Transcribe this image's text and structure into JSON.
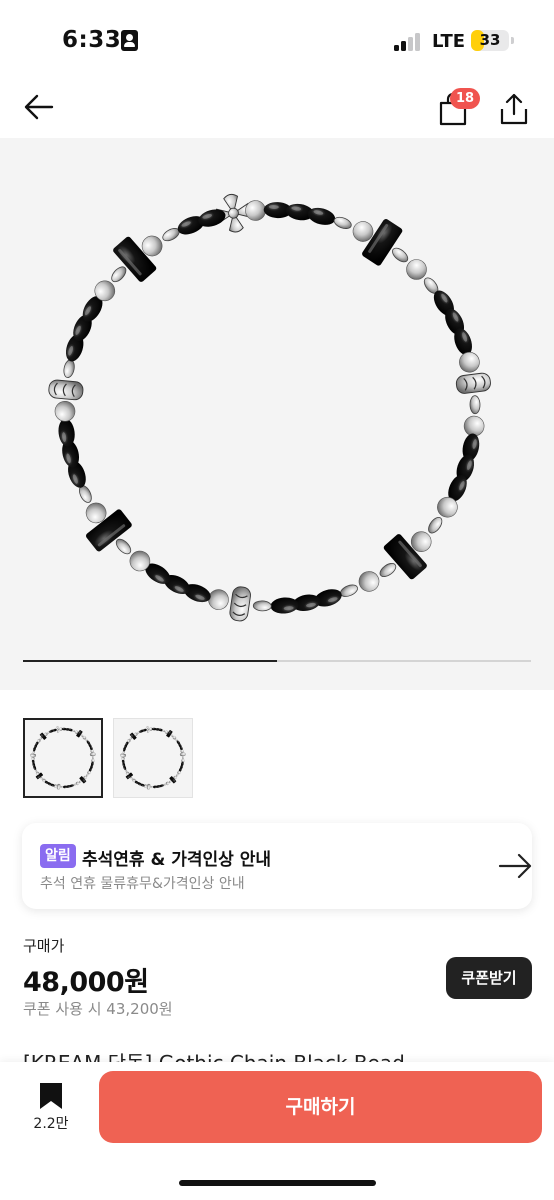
{
  "status_bar": {
    "time": "6:33",
    "network": "LTE",
    "battery_level": "33",
    "battery_color": "#ffcf0a",
    "person_icon": "person-badge-icon",
    "signal_bars_active": 2,
    "signal_bars_total": 4
  },
  "nav": {
    "back_icon": "arrow-left-icon",
    "bag_icon": "shopping-bag-icon",
    "bag_count": "18",
    "share_icon": "share-icon"
  },
  "gallery": {
    "image": "silver-and-black-beaded-bracelet",
    "progress_fraction": 0.5,
    "thumbnails": [
      {
        "image": "beaded-bracelet-thumbnail",
        "selected": true
      },
      {
        "image": "beaded-bracelet-thumbnail",
        "selected": false
      }
    ]
  },
  "notice": {
    "tag": "알림",
    "title": "추석연휴 & 가격인상 안내",
    "subtitle": "추석 연휴 물류휴무&가격인상 안내",
    "arrow_icon": "arrow-right-icon",
    "tag_color": "#8a6cf0"
  },
  "price": {
    "label": "구매가",
    "value": "48,000원",
    "coupon_price": "쿠폰 사용 시 43,200원",
    "coupon_button": "쿠폰받기"
  },
  "product": {
    "title_partial": "[KREAM 단독] Gothic Chain Black Bead"
  },
  "bottom_bar": {
    "bookmark_icon": "bookmark-icon",
    "bookmark_count": "2.2만",
    "buy_button": "구매하기",
    "buy_color": "#ef6253"
  }
}
